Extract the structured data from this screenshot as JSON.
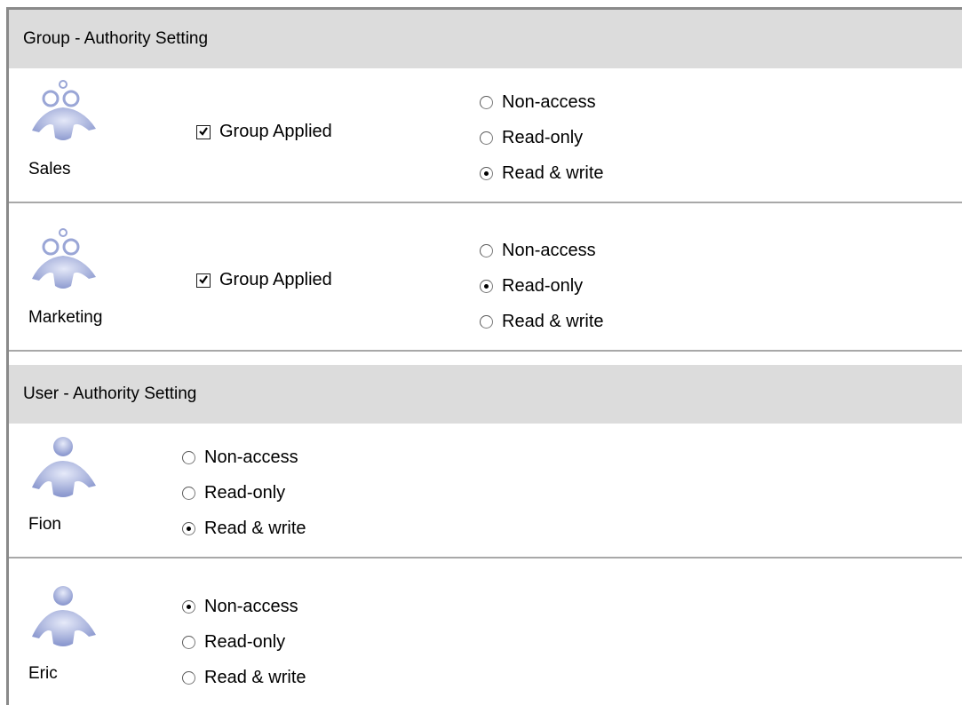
{
  "group_section": {
    "title": "Group - Authority Setting",
    "groups": [
      {
        "name": "Sales",
        "applied_label": "Group Applied",
        "applied": true,
        "options": [
          "Non-access",
          "Read-only",
          "Read & write"
        ],
        "selected": 2
      },
      {
        "name": "Marketing",
        "applied_label": "Group Applied",
        "applied": true,
        "options": [
          "Non-access",
          "Read-only",
          "Read & write"
        ],
        "selected": 1
      }
    ]
  },
  "user_section": {
    "title": "User - Authority Setting",
    "users": [
      {
        "name": "Fion",
        "options": [
          "Non-access",
          "Read-only",
          "Read & write"
        ],
        "selected": 2
      },
      {
        "name": "Eric",
        "options": [
          "Non-access",
          "Read-only",
          "Read & write"
        ],
        "selected": 0
      }
    ]
  },
  "icons": {
    "group": "group-users-icon",
    "user": "user-icon"
  }
}
